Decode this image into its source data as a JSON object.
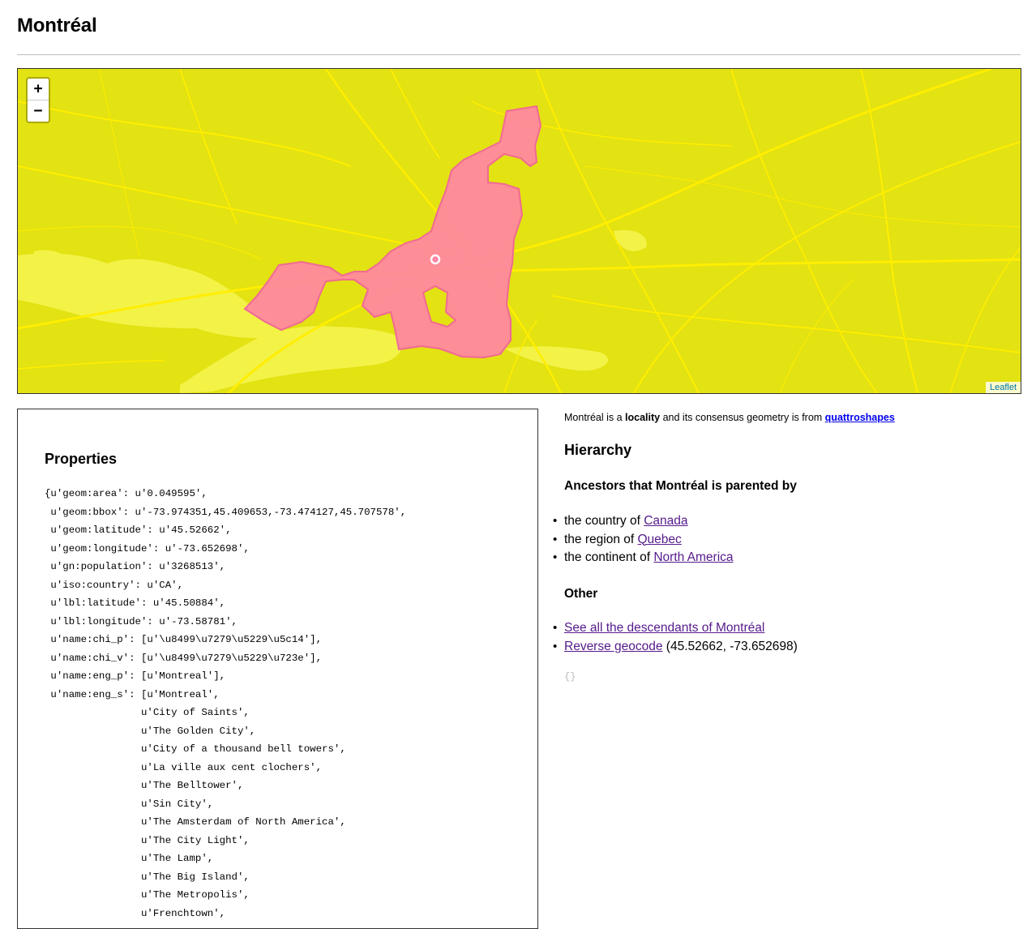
{
  "page": {
    "title": "Montréal"
  },
  "map": {
    "zoom_in": "+",
    "zoom_out": "−",
    "attribution": "Leaflet",
    "colors": {
      "land": "#e3e212",
      "roads": "#ffee00",
      "water": "#f1f045",
      "locality_fill": "#ff85a2",
      "locality_stroke": "#f06a93"
    }
  },
  "properties": {
    "heading": "Properties",
    "lines": [
      "{u'geom:area': u'0.049595',",
      " u'geom:bbox': u'-73.974351,45.409653,-73.474127,45.707578',",
      " u'geom:latitude': u'45.52662',",
      " u'geom:longitude': u'-73.652698',",
      " u'gn:population': u'3268513',",
      " u'iso:country': u'CA',",
      " u'lbl:latitude': u'45.50884',",
      " u'lbl:longitude': u'-73.58781',",
      " u'name:chi_p': [u'\\u8499\\u7279\\u5229\\u5c14'],",
      " u'name:chi_v': [u'\\u8499\\u7279\\u5229\\u723e'],",
      " u'name:eng_p': [u'Montreal'],",
      " u'name:eng_s': [u'Montreal',",
      "                u'City of Saints',",
      "                u'The Golden City',",
      "                u'City of a thousand bell towers',",
      "                u'La ville aux cent clochers',",
      "                u'The Belltower',",
      "                u'Sin City',",
      "                u'The Amsterdam of North America',",
      "                u'The City Light',",
      "                u'The Lamp',",
      "                u'The Big Island',",
      "                u'The Metropolis',",
      "                u'Frenchtown',"
    ]
  },
  "info": {
    "intro_prefix": "Montréal is a ",
    "placetype": "locality",
    "intro_middle": " and its consensus geometry is from ",
    "source_link": "quattroshapes",
    "hierarchy_heading": "Hierarchy",
    "ancestors_heading": "Ancestors that Montréal is parented by",
    "ancestors": [
      {
        "prefix": "the country of ",
        "link": "Canada"
      },
      {
        "prefix": "the region of ",
        "link": "Quebec"
      },
      {
        "prefix": "the continent of ",
        "link": "North America"
      }
    ],
    "other_heading": "Other",
    "descendants_link": "See all the descendants of Montréal",
    "reverse_geocode_link": "Reverse geocode",
    "reverse_geocode_coords": " (45.52662, -73.652698)",
    "empty_json": "{}"
  }
}
